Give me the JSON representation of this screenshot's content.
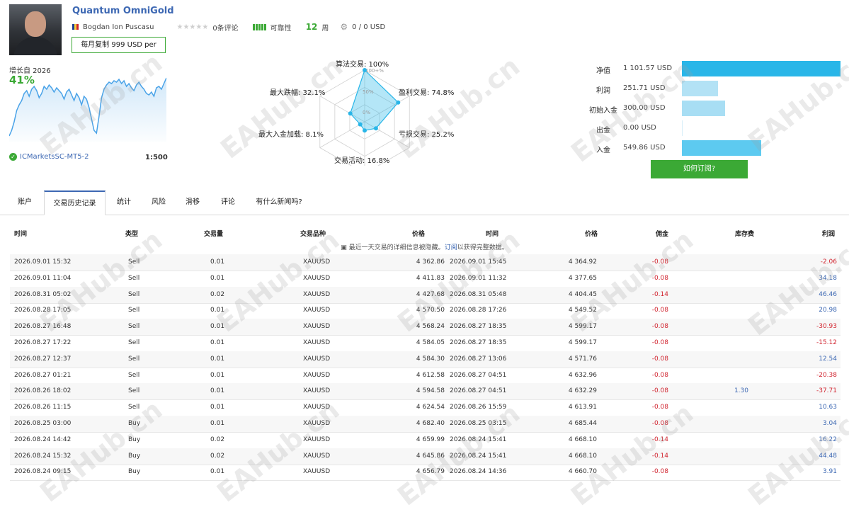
{
  "header": {
    "title": "Quantum OmniGold",
    "author": "Bogdan Ion Puscasu",
    "stars": "★★★★★",
    "reviews": "0条评论",
    "reliability_label": "可靠性",
    "weeks_value": "12",
    "weeks_unit": "周",
    "subscribers": "0 / 0 USD",
    "copy_button": "每月复制 999 USD per"
  },
  "growth": {
    "label": "增长自 2026",
    "value": "41%",
    "broker": "ICMarketsSC-MT5-2",
    "leverage": "1:500",
    "series": [
      0,
      4,
      10,
      18,
      22,
      25,
      30,
      32,
      28,
      33,
      35,
      32,
      27,
      30,
      35,
      33,
      36,
      34,
      31,
      34,
      32,
      30,
      26,
      31,
      33,
      29,
      25,
      30,
      27,
      22,
      28,
      26,
      20,
      12,
      4,
      2,
      14,
      27,
      33,
      36,
      38,
      37,
      39,
      38,
      40,
      37,
      39,
      35,
      37,
      34,
      32,
      36,
      38,
      35,
      33,
      30,
      29,
      31,
      28,
      34,
      35,
      33,
      37,
      41
    ],
    "accent": "#3ba935",
    "line_color": "#4aa3e8"
  },
  "radar": {
    "labels": {
      "top": "算法交易: 100%",
      "right_top": "盈利交易: 74.8%",
      "right_bottom": "亏损交易: 25.2%",
      "bottom": "交易活动: 16.8%",
      "left_bottom": "最大入金加载: 8.1%",
      "left_top": "最大跌幅: 32.1%"
    },
    "values": [
      1.0,
      0.748,
      0.252,
      0.168,
      0.081,
      0.321
    ],
    "ticks": [
      "100+%",
      "50%",
      "0%"
    ]
  },
  "balance": {
    "items": [
      {
        "label": "净值",
        "value": "1 101.57 USD",
        "fraction": 1.0,
        "color": "#29b6e8"
      },
      {
        "label": "利润",
        "value": "251.71 USD",
        "fraction": 0.228,
        "color": "#b3e2f5"
      },
      {
        "label": "初始入金",
        "value": "300.00 USD",
        "fraction": 0.272,
        "color": "#a8def4"
      },
      {
        "label": "出金",
        "value": "0.00 USD",
        "fraction": 0.0,
        "color": "#a8def4"
      },
      {
        "label": "入金",
        "value": "549.86 USD",
        "fraction": 0.499,
        "color": "#5dcaf0"
      }
    ],
    "button": "如何订阅?"
  },
  "tabs": [
    "账户",
    "交易历史记录",
    "统计",
    "风险",
    "滑移",
    "评论",
    "有什么新闻吗?"
  ],
  "table": {
    "headers": [
      "时间",
      "类型",
      "交易量",
      "交易品种",
      "价格",
      "时间",
      "价格",
      "佣金",
      "库存费",
      "利润"
    ],
    "notice_prefix": "最近一天交易的详细信息被隐藏。",
    "notice_link": "订阅",
    "notice_suffix": "以获得完整数据。",
    "rows": [
      [
        "2026.09.01 15:32",
        "Sell",
        "0.01",
        "XAUUSD",
        "4 362.86",
        "2026.09.01 15:45",
        "4 364.92",
        "-0.08",
        "",
        "-2.06"
      ],
      [
        "2026.09.01 11:04",
        "Sell",
        "0.01",
        "XAUUSD",
        "4 411.83",
        "2026.09.01 11:32",
        "4 377.65",
        "-0.08",
        "",
        "34.18"
      ],
      [
        "2026.08.31 05:02",
        "Sell",
        "0.02",
        "XAUUSD",
        "4 427.68",
        "2026.08.31 05:48",
        "4 404.45",
        "-0.14",
        "",
        "46.46"
      ],
      [
        "2026.08.28 17:05",
        "Sell",
        "0.01",
        "XAUUSD",
        "4 570.50",
        "2026.08.28 17:26",
        "4 549.52",
        "-0.08",
        "",
        "20.98"
      ],
      [
        "2026.08.27 16:48",
        "Sell",
        "0.01",
        "XAUUSD",
        "4 568.24",
        "2026.08.27 18:35",
        "4 599.17",
        "-0.08",
        "",
        "-30.93"
      ],
      [
        "2026.08.27 17:22",
        "Sell",
        "0.01",
        "XAUUSD",
        "4 584.05",
        "2026.08.27 18:35",
        "4 599.17",
        "-0.08",
        "",
        "-15.12"
      ],
      [
        "2026.08.27 12:37",
        "Sell",
        "0.01",
        "XAUUSD",
        "4 584.30",
        "2026.08.27 13:06",
        "4 571.76",
        "-0.08",
        "",
        "12.54"
      ],
      [
        "2026.08.27 01:21",
        "Sell",
        "0.01",
        "XAUUSD",
        "4 612.58",
        "2026.08.27 04:51",
        "4 632.96",
        "-0.08",
        "",
        "-20.38"
      ],
      [
        "2026.08.26 18:02",
        "Sell",
        "0.01",
        "XAUUSD",
        "4 594.58",
        "2026.08.27 04:51",
        "4 632.29",
        "-0.08",
        "1.30",
        "-37.71"
      ],
      [
        "2026.08.26 11:15",
        "Sell",
        "0.01",
        "XAUUSD",
        "4 624.54",
        "2026.08.26 15:59",
        "4 613.91",
        "-0.08",
        "",
        "10.63"
      ],
      [
        "2026.08.25 03:00",
        "Buy",
        "0.01",
        "XAUUSD",
        "4 682.40",
        "2026.08.25 03:15",
        "4 685.44",
        "-0.08",
        "",
        "3.04"
      ],
      [
        "2026.08.24 14:42",
        "Buy",
        "0.02",
        "XAUUSD",
        "4 659.99",
        "2026.08.24 15:41",
        "4 668.10",
        "-0.14",
        "",
        "16.22"
      ],
      [
        "2026.08.24 15:32",
        "Buy",
        "0.02",
        "XAUUSD",
        "4 645.86",
        "2026.08.24 15:41",
        "4 668.10",
        "-0.14",
        "",
        "44.48"
      ],
      [
        "2026.08.24 09:15",
        "Buy",
        "0.01",
        "XAUUSD",
        "4 656.79",
        "2026.08.24 14:36",
        "4 660.70",
        "-0.08",
        "",
        "3.91"
      ]
    ]
  },
  "watermark": "EAHub.cn"
}
